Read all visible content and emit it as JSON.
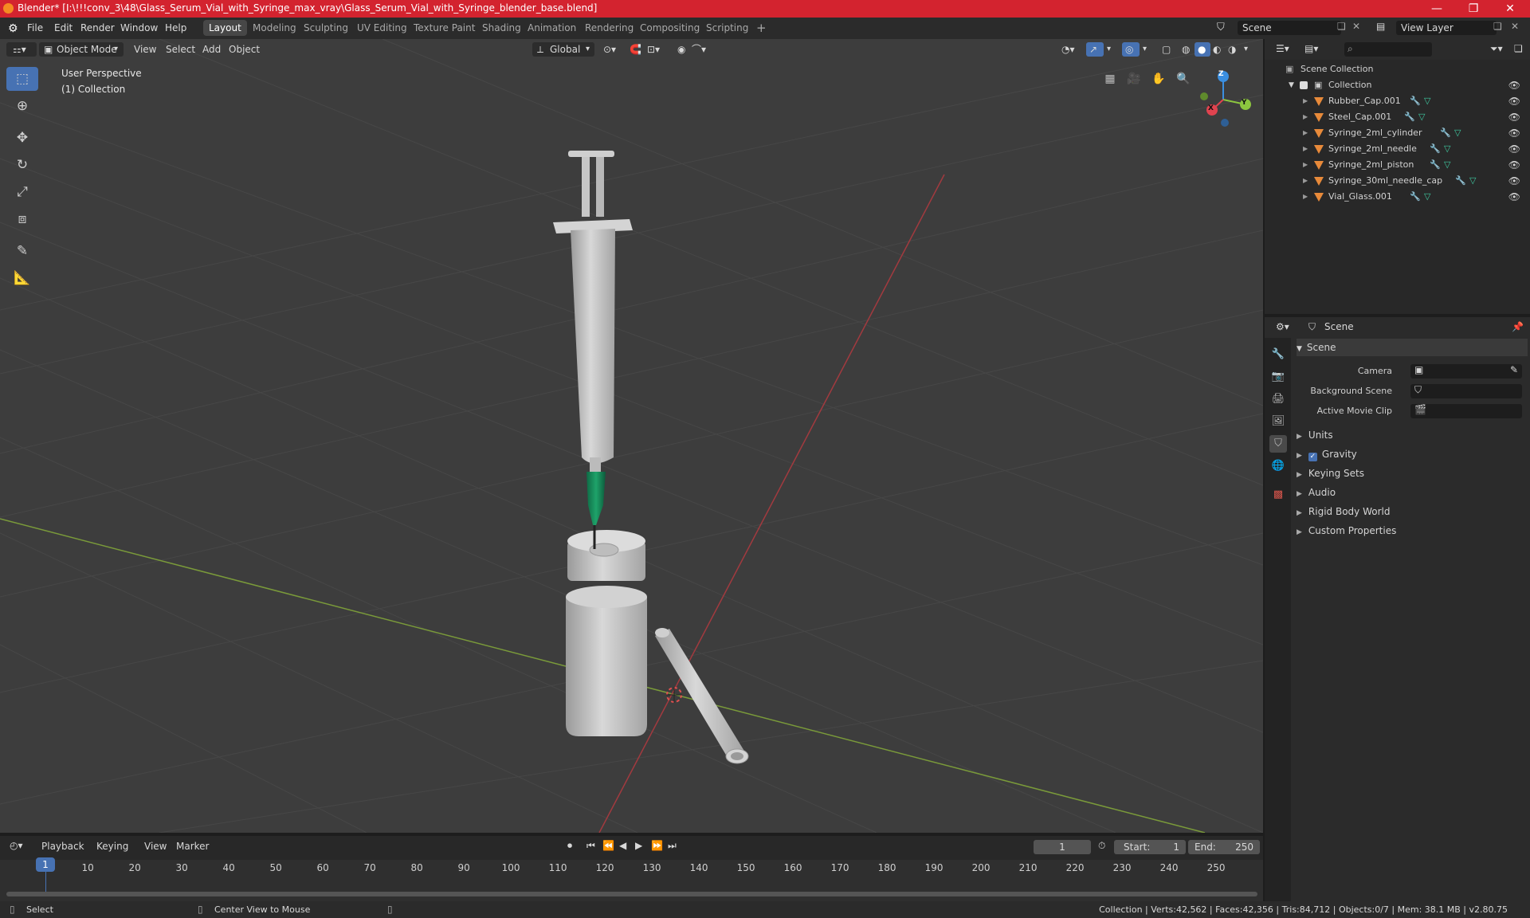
{
  "window": {
    "title": "Blender* [I:\\!!!conv_3\\48\\Glass_Serum_Vial_with_Syringe_max_vray\\Glass_Serum_Vial_with_Syringe_blender_base.blend]",
    "controls": {
      "minimize": "—",
      "maximize": "❐",
      "close": "✕"
    }
  },
  "menu": [
    "File",
    "Edit",
    "Render",
    "Window",
    "Help"
  ],
  "workspaces": [
    "Layout",
    "Modeling",
    "Sculpting",
    "UV Editing",
    "Texture Paint",
    "Shading",
    "Animation",
    "Rendering",
    "Compositing",
    "Scripting"
  ],
  "workspace_active": "Layout",
  "add_workspace": "+",
  "scene_field": "Scene",
  "view_layer_field": "View Layer",
  "viewport": {
    "mode": "Object Mode",
    "menus": [
      "View",
      "Select",
      "Add",
      "Object"
    ],
    "transform_orientation": "Global",
    "overlay_line1": "User Perspective",
    "overlay_line2": "(1) Collection",
    "gizmo": {
      "x": "X",
      "y": "Y",
      "z": "Z"
    }
  },
  "tools": [
    "select-box",
    "cursor",
    "move",
    "rotate",
    "scale",
    "transform",
    "annotate",
    "measure"
  ],
  "outliner": {
    "root": "Scene Collection",
    "collection": "Collection",
    "objects": [
      "Rubber_Cap.001",
      "Steel_Cap.001",
      "Syringe_2ml_cylinder",
      "Syringe_2ml_needle",
      "Syringe_2ml_piston",
      "Syringe_30ml_needle_cap",
      "Vial_Glass.001"
    ]
  },
  "properties": {
    "context": "Scene",
    "panel": "Scene",
    "camera_label": "Camera",
    "bg_scene_label": "Background Scene",
    "movie_clip_label": "Active Movie Clip",
    "sections": [
      "Units",
      "Gravity",
      "Keying Sets",
      "Audio",
      "Rigid Body World",
      "Custom Properties"
    ],
    "gravity_checked": true
  },
  "timeline": {
    "menus": [
      "Playback",
      "Keying",
      "View",
      "Marker"
    ],
    "current_frame": "1",
    "start_label": "Start:",
    "start": "1",
    "end_label": "End:",
    "end": "250",
    "ticks": [
      "1",
      "10",
      "20",
      "30",
      "40",
      "50",
      "60",
      "70",
      "80",
      "90",
      "100",
      "110",
      "120",
      "130",
      "140",
      "150",
      "160",
      "170",
      "180",
      "190",
      "200",
      "210",
      "220",
      "230",
      "240",
      "250"
    ]
  },
  "statusbar": {
    "left": "Select",
    "middle": "Center View to Mouse",
    "right": "Collection | Verts:42,562 | Faces:42,356 | Tris:84,712 | Objects:0/7 | Mem: 38.1 MB | v2.80.75"
  },
  "colors": {
    "title_bar": "#d3232f",
    "accent": "#4772b3",
    "x_axis": "#e0434f",
    "y_axis": "#8cc63f",
    "z_axis": "#3b8fe0"
  }
}
